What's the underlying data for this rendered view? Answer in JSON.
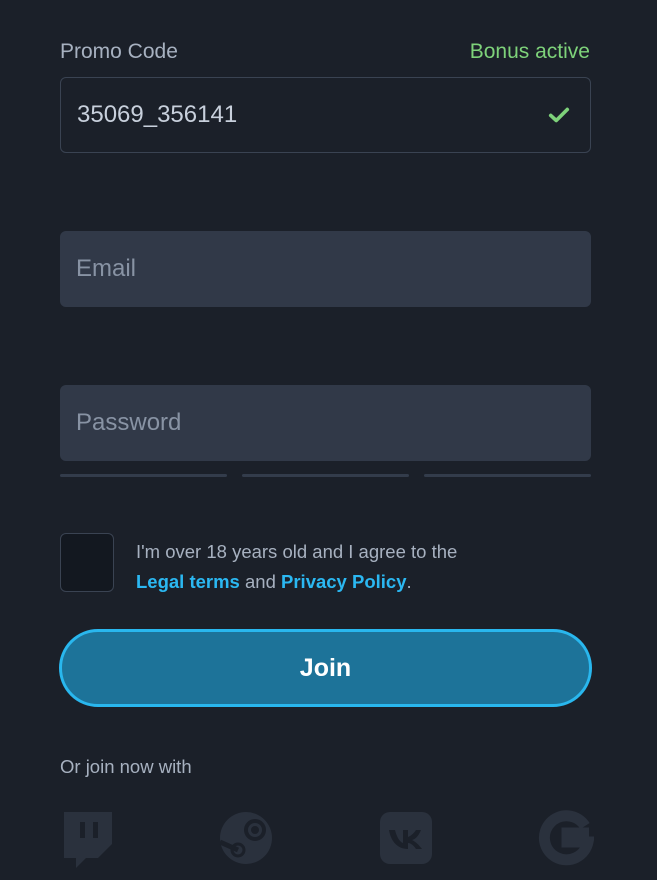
{
  "promo": {
    "label": "Promo Code",
    "status": "Bonus active",
    "value": "35069_356141"
  },
  "email": {
    "placeholder": "Email"
  },
  "password": {
    "placeholder": "Password"
  },
  "agreement": {
    "text_before": "I'm over 18 years old and I agree to the",
    "legal_link": "Legal terms",
    "connector": "and",
    "privacy_link": "Privacy Policy",
    "trailing": "."
  },
  "join": {
    "label": "Join"
  },
  "social": {
    "label": "Or join now with",
    "providers": [
      "twitch-icon",
      "steam-icon",
      "vk-icon",
      "google-icon"
    ]
  },
  "colors": {
    "background": "#1b2029",
    "field": "#313948",
    "accent": "#29b7ee",
    "success": "#7ed27a",
    "link": "#2bb8f2"
  }
}
